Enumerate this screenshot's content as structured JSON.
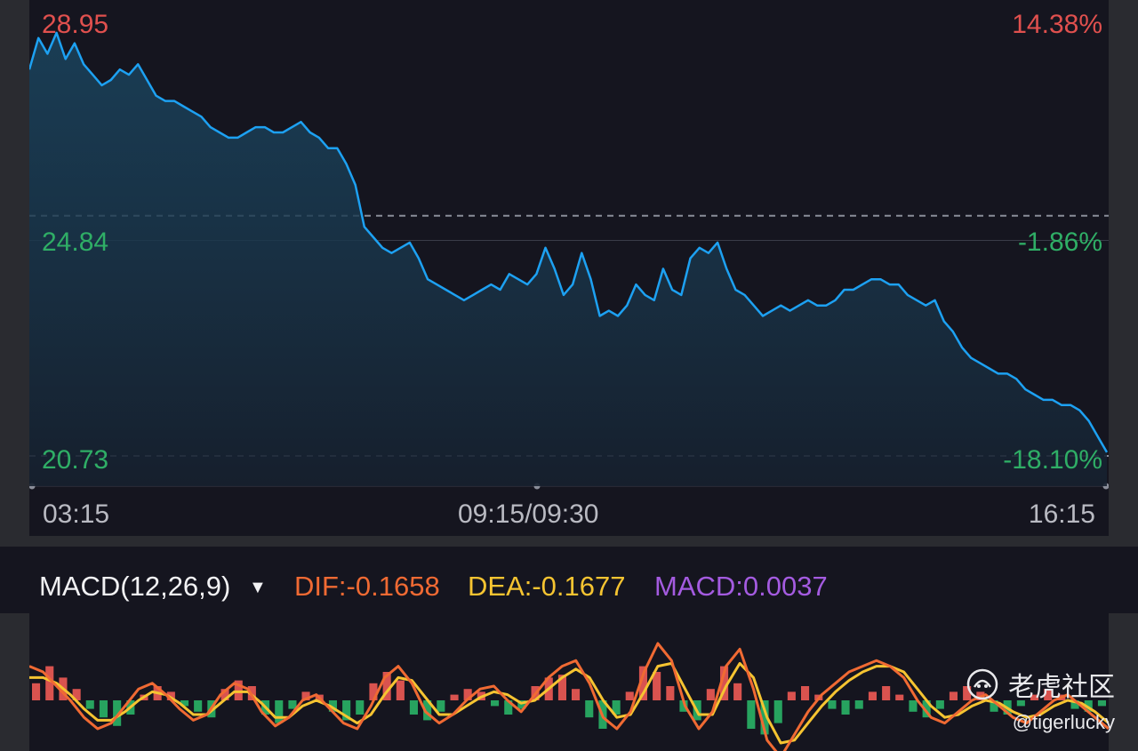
{
  "price_axis": {
    "left_labels": [
      {
        "text": "28.95",
        "trend": "up"
      },
      {
        "text": "24.84",
        "trend": "down"
      },
      {
        "text": "20.73",
        "trend": "down"
      }
    ],
    "right_labels": [
      {
        "text": "14.38%",
        "trend": "up"
      },
      {
        "text": "-1.86%",
        "trend": "down"
      },
      {
        "text": "-18.10%",
        "trend": "down"
      }
    ]
  },
  "time_axis": {
    "start": "03:15",
    "middle": "09:15/09:30",
    "end": "16:15"
  },
  "macd_header": {
    "indicator": "MACD(12,26,9)",
    "dif": "DIF:-0.1658",
    "dea": "DEA:-0.1677",
    "macd": "MACD:0.0037",
    "colors": {
      "indicator": "#f2f2f4",
      "dif": "#f06a33",
      "dea": "#f6c431",
      "macd": "#a45be0"
    }
  },
  "watermark": {
    "logo_text": "老虎社区",
    "handle": "@tigerlucky"
  },
  "colors": {
    "price_line": "#1da1f2",
    "up": "#e0504e",
    "down": "#2fae66",
    "dif_line": "#f06a33",
    "dea_line": "#f6c431",
    "hist_up": "#d9534f",
    "hist_down": "#27a35f"
  },
  "chart_data": {
    "type": "line",
    "y_range": [
      20.73,
      28.95
    ],
    "reference_price": 25.31,
    "x_range_labels": [
      "03:15",
      "09:15/09:30",
      "16:15"
    ],
    "price": [
      28.1,
      28.7,
      28.4,
      28.8,
      28.3,
      28.6,
      28.2,
      28.0,
      27.8,
      27.9,
      28.1,
      28.0,
      28.2,
      27.9,
      27.6,
      27.5,
      27.5,
      27.4,
      27.3,
      27.2,
      27.0,
      26.9,
      26.8,
      26.8,
      26.9,
      27.0,
      27.0,
      26.9,
      26.9,
      27.0,
      27.1,
      26.9,
      26.8,
      26.6,
      26.6,
      26.3,
      25.9,
      25.1,
      24.9,
      24.7,
      24.6,
      24.7,
      24.8,
      24.5,
      24.1,
      24.0,
      23.9,
      23.8,
      23.7,
      23.8,
      23.9,
      24.0,
      23.9,
      24.2,
      24.1,
      24.0,
      24.2,
      24.7,
      24.3,
      23.8,
      24.0,
      24.6,
      24.1,
      23.4,
      23.5,
      23.4,
      23.6,
      24.0,
      23.8,
      23.7,
      24.3,
      23.9,
      23.8,
      24.5,
      24.7,
      24.6,
      24.8,
      24.3,
      23.9,
      23.8,
      23.6,
      23.4,
      23.5,
      23.6,
      23.5,
      23.6,
      23.7,
      23.6,
      23.6,
      23.7,
      23.9,
      23.9,
      24.0,
      24.1,
      24.1,
      24.0,
      24.0,
      23.8,
      23.7,
      23.6,
      23.7,
      23.3,
      23.1,
      22.8,
      22.6,
      22.5,
      22.4,
      22.3,
      22.3,
      22.2,
      22.0,
      21.9,
      21.8,
      21.8,
      21.7,
      21.7,
      21.6,
      21.4,
      21.1,
      20.8
    ],
    "macd_histogram": [
      0.06,
      0.12,
      0.08,
      0.04,
      -0.03,
      -0.06,
      -0.09,
      -0.05,
      0.02,
      0.05,
      0.03,
      -0.02,
      -0.04,
      -0.06,
      0.04,
      0.07,
      0.05,
      -0.05,
      -0.08,
      -0.03,
      0.03,
      0.02,
      -0.04,
      -0.07,
      -0.05,
      0.06,
      0.1,
      0.07,
      -0.05,
      -0.07,
      -0.04,
      0.02,
      0.04,
      0.03,
      -0.02,
      -0.05,
      -0.03,
      0.05,
      0.08,
      0.09,
      0.04,
      -0.06,
      -0.1,
      -0.05,
      0.03,
      0.12,
      0.1,
      0.05,
      -0.04,
      -0.07,
      0.04,
      0.12,
      0.06,
      -0.1,
      -0.12,
      -0.08,
      0.03,
      0.05,
      0.02,
      -0.03,
      -0.05,
      -0.03,
      0.03,
      0.05,
      0.02,
      -0.04,
      -0.06,
      -0.03,
      0.03,
      0.05,
      0.03,
      -0.04,
      -0.05,
      -0.02,
      0.02,
      0.04,
      0.02,
      -0.03,
      -0.04,
      -0.02
    ],
    "dif": [
      0.12,
      0.1,
      0.05,
      0.0,
      -0.06,
      -0.1,
      -0.08,
      -0.02,
      0.04,
      0.06,
      0.02,
      -0.03,
      -0.07,
      -0.05,
      0.02,
      0.06,
      0.04,
      -0.04,
      -0.09,
      -0.06,
      0.0,
      0.02,
      -0.03,
      -0.08,
      -0.1,
      -0.02,
      0.08,
      0.12,
      0.06,
      -0.04,
      -0.08,
      -0.05,
      0.0,
      0.04,
      0.05,
      0.0,
      -0.04,
      0.02,
      0.08,
      0.12,
      0.14,
      0.06,
      -0.06,
      -0.1,
      -0.04,
      0.1,
      0.2,
      0.14,
      -0.02,
      -0.1,
      -0.04,
      0.12,
      0.18,
      0.04,
      -0.14,
      -0.2,
      -0.12,
      -0.04,
      0.02,
      0.06,
      0.1,
      0.12,
      0.14,
      0.12,
      0.08,
      0.0,
      -0.06,
      -0.08,
      -0.04,
      0.0,
      0.02,
      -0.02,
      -0.06,
      -0.08,
      -0.04,
      0.0,
      0.02,
      -0.02,
      -0.06,
      -0.1
    ],
    "dea": [
      0.08,
      0.08,
      0.06,
      0.02,
      -0.03,
      -0.07,
      -0.07,
      -0.04,
      0.0,
      0.03,
      0.02,
      -0.01,
      -0.05,
      -0.05,
      -0.01,
      0.03,
      0.03,
      -0.01,
      -0.06,
      -0.06,
      -0.02,
      0.0,
      -0.02,
      -0.05,
      -0.08,
      -0.05,
      0.02,
      0.08,
      0.07,
      0.01,
      -0.05,
      -0.05,
      -0.02,
      0.01,
      0.03,
      0.02,
      -0.01,
      0.0,
      0.04,
      0.08,
      0.11,
      0.08,
      0.0,
      -0.06,
      -0.05,
      0.03,
      0.12,
      0.13,
      0.04,
      -0.05,
      -0.05,
      0.05,
      0.13,
      0.08,
      -0.06,
      -0.15,
      -0.14,
      -0.08,
      -0.02,
      0.03,
      0.07,
      0.1,
      0.12,
      0.12,
      0.1,
      0.04,
      -0.02,
      -0.06,
      -0.05,
      -0.02,
      0.0,
      -0.01,
      -0.04,
      -0.06,
      -0.05,
      -0.02,
      0.0,
      -0.01,
      -0.04,
      -0.08
    ]
  }
}
